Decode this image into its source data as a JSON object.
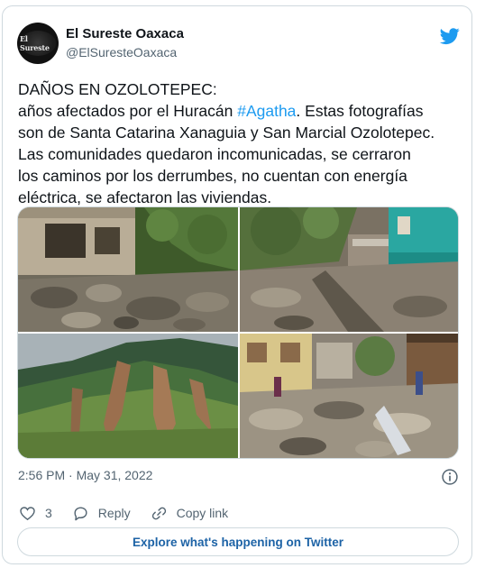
{
  "tweet": {
    "author_name": "El Sureste Oaxaca",
    "author_handle": "@ElSuresteOaxaca",
    "avatar_text": "El Sureste",
    "text_lines": [
      "DAÑOS EN OZOLOTEPEC:",
      "años afectados por el Huracán ",
      "#Agatha",
      ". Estas fotografías",
      "son de Santa Catarina Xanaguia y San Marcial Ozolotepec.",
      "Las comunidades quedaron incomunicadas, se cerraron",
      "los caminos por los derrumbes, no cuentan con energía",
      "eléctrica, se afectaron las viviendas."
    ],
    "timestamp": "2:56 PM · May 31, 2022",
    "like_count": "3",
    "reply_label": "Reply",
    "copy_link_label": "Copy link",
    "explore_label": "Explore what's happening on Twitter"
  },
  "icons": {
    "brand": "twitter-bird-icon",
    "info": "info-icon",
    "like": "heart-icon",
    "reply": "speech-bubble-icon",
    "copy_link": "link-icon"
  },
  "colors": {
    "accent": "#1d9bf0",
    "explore_text": "#1d63a6",
    "secondary_text": "#536471",
    "border": "#cfd9de"
  }
}
